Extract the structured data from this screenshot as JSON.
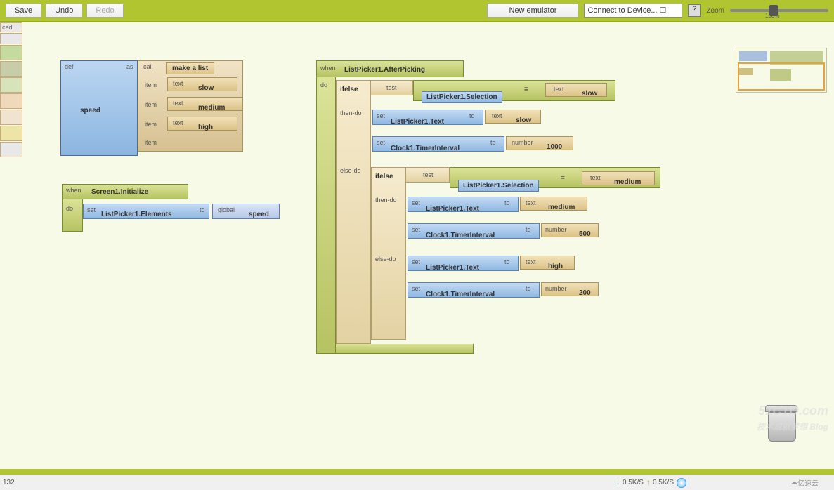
{
  "toolbar": {
    "save": "Save",
    "undo": "Undo",
    "redo": "Redo",
    "new_emulator": "New emulator",
    "connect": "Connect to Device...  ☐",
    "help": "?",
    "zoom": "Zoom",
    "zoom_pct": "100%"
  },
  "sidebar": {
    "tab1": "ced"
  },
  "defblock": {
    "def": "def",
    "as": "as",
    "name": "speed",
    "call": "call",
    "make_a_list": "make a list",
    "item": "item",
    "text": "text",
    "v1": "slow",
    "v2": "medium",
    "v3": "high"
  },
  "initblock": {
    "when": "when",
    "title": "Screen1.Initialize",
    "do": "do",
    "set": "set",
    "target": "ListPicker1.Elements",
    "to": "to",
    "global": "global",
    "var": "speed"
  },
  "afterpick": {
    "when": "when",
    "title": "ListPicker1.AfterPicking",
    "do": "do",
    "ifelse": "ifelse",
    "test": "test",
    "selection": "ListPicker1.Selection",
    "eq": "=",
    "text": "text",
    "slow": "slow",
    "medium": "medium",
    "high": "high",
    "then_do": "then-do",
    "else_do": "else-do",
    "set": "set",
    "to": "to",
    "lp_text": "ListPicker1.Text",
    "clock": "Clock1.TimerInterval",
    "number": "number",
    "n1000": "1000",
    "n500": "500",
    "n200": "200"
  },
  "status": {
    "num": "132",
    "down": "0.5K/S",
    "up": "0.5K/S",
    "cloud": "亿速云"
  },
  "watermark": {
    "top": "51CTO.com",
    "bottom": "技术成就梦想   Blog"
  }
}
